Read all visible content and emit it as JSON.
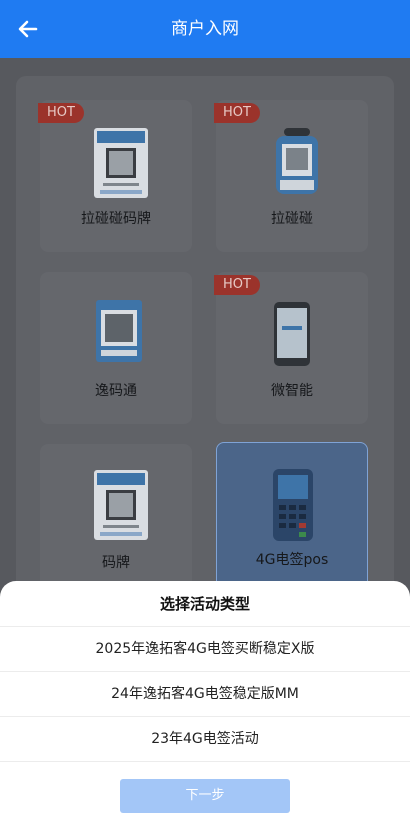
{
  "header": {
    "title": "商户入网"
  },
  "cards": [
    {
      "label": "拉碰碰码牌",
      "hot": "HOT"
    },
    {
      "label": "拉碰碰",
      "hot": "HOT"
    },
    {
      "label": "逸码通",
      "hot": ""
    },
    {
      "label": "微智能",
      "hot": "HOT"
    },
    {
      "label": "码牌",
      "hot": ""
    },
    {
      "label": "4G电签pos",
      "hot": ""
    }
  ],
  "sheet": {
    "title": "选择活动类型",
    "options": [
      "2025年逸拓客4G电签买断稳定X版",
      "24年逸拓客4G电签稳定版MM",
      "23年4G电签活动"
    ],
    "next_label": "下一步"
  },
  "icons": {
    "back": "arrow-left-icon"
  },
  "colors": {
    "brand": "#1f7bf2",
    "hot_badge": "#9b332b",
    "next_button_disabled": "#a3c6f7"
  }
}
